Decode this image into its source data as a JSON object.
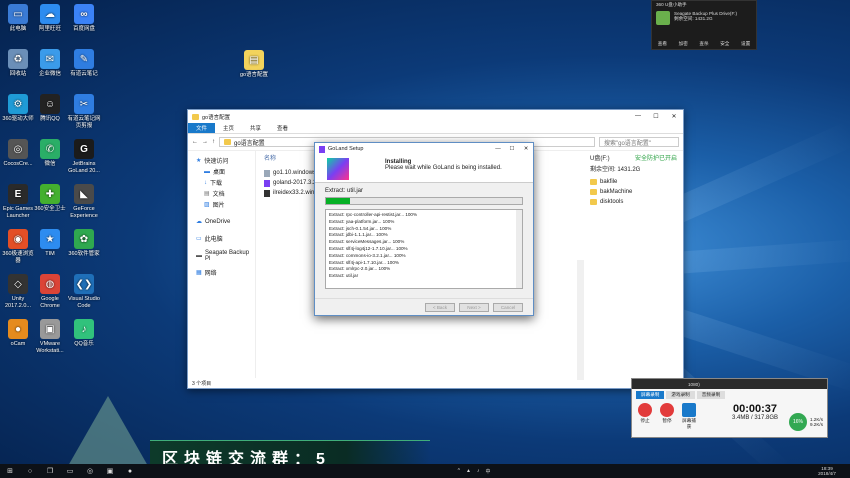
{
  "desktop_icons": [
    {
      "label": "此电脑",
      "color": "#3a7bd5",
      "glyph": "▭"
    },
    {
      "label": "阿里旺旺",
      "color": "#2d8cf0",
      "glyph": "☁"
    },
    {
      "label": "百度网盘",
      "color": "#3b82f6",
      "glyph": "∞"
    },
    {
      "label": "回收站",
      "color": "#6b8fb8",
      "glyph": "♻"
    },
    {
      "label": "企业微信",
      "color": "#3b9bea",
      "glyph": "✉"
    },
    {
      "label": "有道云笔记",
      "color": "#2f7de1",
      "glyph": "✎"
    },
    {
      "label": "360驱动大师",
      "color": "#1f9bd6",
      "glyph": "⚙"
    },
    {
      "label": "腾讯QQ",
      "color": "#222222",
      "glyph": "☺"
    },
    {
      "label": "有道云笔记网页剪报",
      "color": "#2f7de1",
      "glyph": "✂"
    },
    {
      "label": "CocosCre...",
      "color": "#555555",
      "glyph": "◎"
    },
    {
      "label": "微信",
      "color": "#2aae67",
      "glyph": "✆"
    },
    {
      "label": "JetBrains GoLand 20...",
      "color": "#1b1b1b",
      "glyph": "G"
    },
    {
      "label": "Epic Games Launcher",
      "color": "#2a2a2a",
      "glyph": "E"
    },
    {
      "label": "360安全卫士",
      "color": "#44b02f",
      "glyph": "✚"
    },
    {
      "label": "GeForce Experience",
      "color": "#4a4a4a",
      "glyph": "◣"
    },
    {
      "label": "360极速浏览器",
      "color": "#e34f26",
      "glyph": "◉"
    },
    {
      "label": "TIM",
      "color": "#2d8cf0",
      "glyph": "★"
    },
    {
      "label": "360软件管家",
      "color": "#2fa84f",
      "glyph": "✿"
    },
    {
      "label": "Unity 2017.2.0...",
      "color": "#333333",
      "glyph": "◇"
    },
    {
      "label": "Google Chrome",
      "color": "#db4437",
      "glyph": "◍"
    },
    {
      "label": "Visual Studio Code",
      "color": "#1f6fb8",
      "glyph": "❮❯"
    },
    {
      "label": "oCam",
      "color": "#e58b1e",
      "glyph": "●"
    },
    {
      "label": "VMware Workstati...",
      "color": "#999999",
      "glyph": "▣"
    },
    {
      "label": "QQ音乐",
      "color": "#31c27c",
      "glyph": "♪"
    }
  ],
  "desktop_folder": {
    "label": "go语言配置"
  },
  "explorer": {
    "title": "go语言配置",
    "ribbon": [
      "文件",
      "主页",
      "共享",
      "查看"
    ],
    "address": "go语言配置",
    "search_placeholder": "搜索\"go语言配置\"",
    "nav": [
      "快速访问",
      "桌面",
      "下载",
      "文档",
      "图片",
      "OneDrive",
      "此电脑",
      "Seagate Backup Pl",
      "网络"
    ],
    "files_header": "名称",
    "files": [
      "go1.10.windows",
      "goland-2017.3.2",
      "ilreidex33.2.wind"
    ],
    "status": "3 个项目",
    "drive": "U盘(F:)",
    "drive_status": "安全防护已开启",
    "free_space": "剩余空间: 1431.2G",
    "drive_folders": [
      "bakfile",
      "bakMachine",
      "disktools"
    ]
  },
  "setup": {
    "title": "GoLand Setup",
    "heading": "Installing",
    "subheading": "Please wait while GoLand is being installed.",
    "current": "Extract: util.jar",
    "progress": 0.12,
    "log": [
      "Extract: rpc-controller-api-restist.jar... 100%",
      "Extract: yaa-platform.jar... 100%",
      "Extract: jsch-0.1.54.jar... 100%",
      "Extract: jdbi-1.1.1.jar... 100%",
      "Extract: serviceMessages.jar... 100%",
      "Extract: slf4j-log4j12-1.7.10.jar... 100%",
      "Extract: commons-io-3.2.1.jar... 100%",
      "Extract: slf4j-api-1.7.10.jar... 100%",
      "Extract: xmlrpc-2.0.jar... 100%",
      "Extract: util.jar"
    ],
    "btn_back": "< Back",
    "btn_next": "Next >",
    "btn_cancel": "Cancel"
  },
  "widget360": {
    "title": "360 U盘小助手",
    "device": "Seagate Backup Plus Drive(F:)",
    "space": "剩余空间: 1431.2G",
    "actions": [
      "查看",
      "加密",
      "查杀",
      "安全",
      "设置"
    ]
  },
  "recorder": {
    "title": "1080)",
    "tabs": [
      "屏幕录制",
      "游戏录制",
      "音频录制"
    ],
    "stop": "停止",
    "pause": "暂停",
    "capture": "屏幕捕获",
    "time": "00:00:37",
    "size": "3.4MB / 317.8GB",
    "cpu": "16%",
    "up": "1.2K/s",
    "down": "9.2K/s"
  },
  "banner": {
    "text": "区块链交流群：5"
  },
  "taskbar": {
    "time": "18:39",
    "date": "2018/4/7"
  },
  "colors": {
    "accent": "#1979ca",
    "progress": "#06b025"
  }
}
